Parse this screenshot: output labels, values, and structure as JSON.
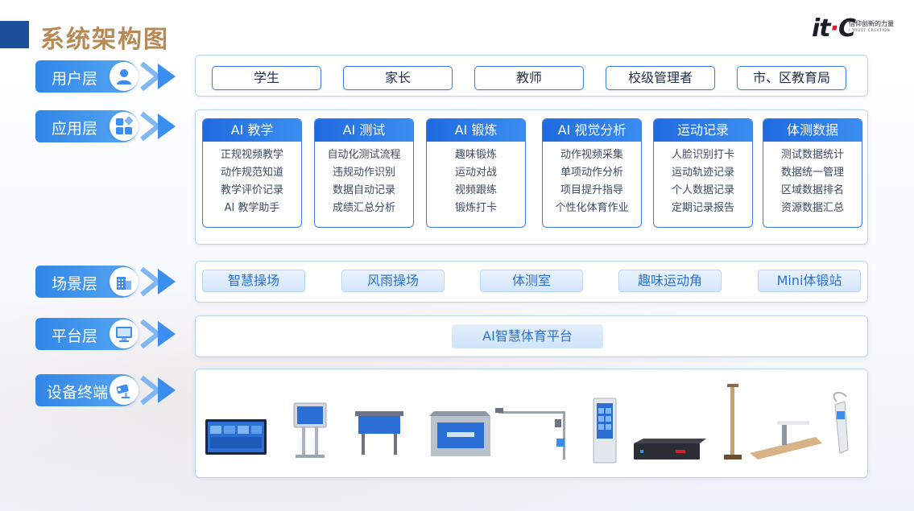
{
  "title": "系统架构图",
  "logo": {
    "mark": "itC",
    "slogan_cn": "信仰创新的力量",
    "slogan_en": "I TRUST CREATION"
  },
  "colors": {
    "accent": "#2f86e8",
    "title": "#b78a55",
    "header_fill": "#1f6ae0",
    "scene_text": "#2c6fd1"
  },
  "layers": [
    {
      "label": "用户层",
      "icon": "user-icon"
    },
    {
      "label": "应用层",
      "icon": "apps-grid-icon"
    },
    {
      "label": "场景层",
      "icon": "building-icon"
    },
    {
      "label": "平台层",
      "icon": "monitor-icon"
    },
    {
      "label": "设备终端",
      "icon": "camera-icon"
    }
  ],
  "users": [
    "学生",
    "家长",
    "教师",
    "校级管理者",
    "市、区教育局"
  ],
  "applications": [
    {
      "title": "AI 教学",
      "items": [
        "正规视频教学",
        "动作规范知道",
        "教学评价记录",
        "AI 教学助手"
      ]
    },
    {
      "title": "AI 测试",
      "items": [
        "自动化测试流程",
        "违规动作识别",
        "数据自动记录",
        "成绩汇总分析"
      ]
    },
    {
      "title": "AI 锻炼",
      "items": [
        "趣味锻炼",
        "运动对战",
        "视频跟练",
        "锻炼打卡"
      ]
    },
    {
      "title": "AI 视觉分析",
      "items": [
        "动作视频采集",
        "单项动作分析",
        "项目提升指导",
        "个性化体育作业"
      ]
    },
    {
      "title": "运动记录",
      "items": [
        "人脸识别打卡",
        "运动轨迹记录",
        "个人数据记录",
        "定期记录报告"
      ]
    },
    {
      "title": "体测数据",
      "items": [
        "测试数据统计",
        "数据统一管理",
        "区域数据排名",
        "资源数据汇总"
      ]
    }
  ],
  "scenes": [
    "智慧操场",
    "风雨操场",
    "体测室",
    "趣味运动角",
    "Mini体锻站"
  ],
  "platform": "AI智慧体育平台",
  "devices": [
    {
      "name": "interactive-display",
      "icon": "display-panel-icon"
    },
    {
      "name": "kiosk-terminal",
      "icon": "kiosk-icon"
    },
    {
      "name": "stand-display",
      "icon": "stand-display-icon"
    },
    {
      "name": "canopy-screen",
      "icon": "canopy-screen-icon"
    },
    {
      "name": "camera-pole",
      "icon": "camera-pole-icon"
    },
    {
      "name": "vertical-kiosk",
      "icon": "vertical-kiosk-icon"
    },
    {
      "name": "server-box",
      "icon": "server-box-icon"
    },
    {
      "name": "height-scale",
      "icon": "height-scale-icon"
    },
    {
      "name": "sit-reach-tester",
      "icon": "sit-reach-icon"
    },
    {
      "name": "grip-tester",
      "icon": "grip-tester-icon"
    }
  ]
}
